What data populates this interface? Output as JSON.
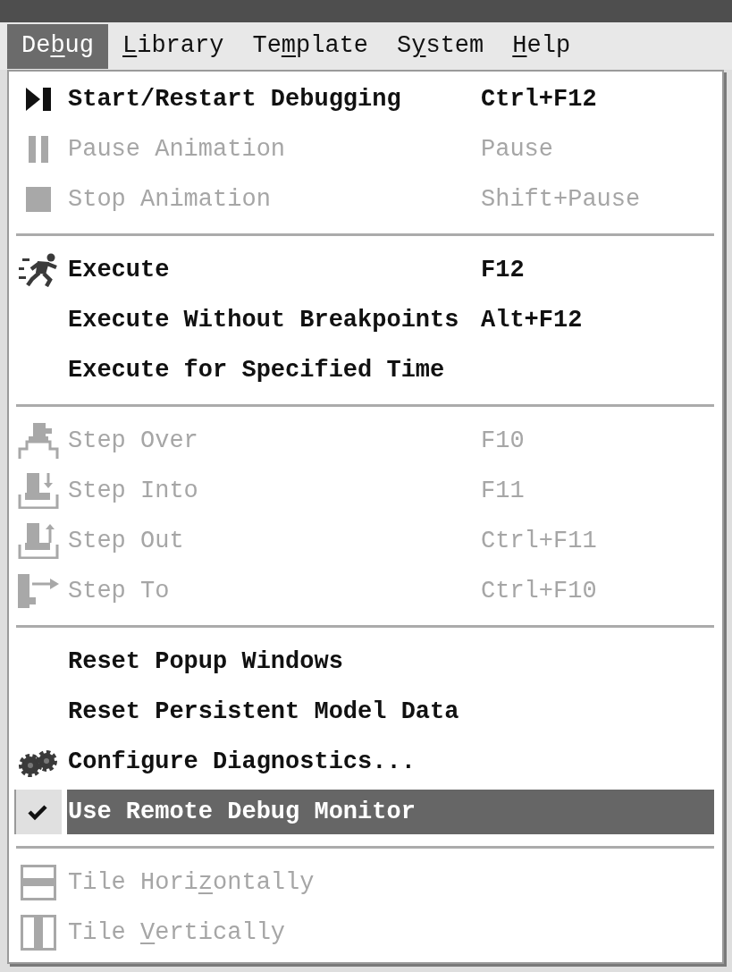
{
  "menu_bar": [
    {
      "label_parts": {
        "before": "De",
        "key": "b",
        "after": "ug"
      },
      "selected": true
    },
    {
      "label_parts": {
        "key": "L",
        "after": "ibrary"
      },
      "selected": false
    },
    {
      "label_parts": {
        "before": "Te",
        "key": "m",
        "after": "plate"
      },
      "selected": false
    },
    {
      "label_parts": {
        "before": "S",
        "key": "y",
        "after": "stem"
      },
      "selected": false
    },
    {
      "label_parts": {
        "key": "H",
        "after": "elp"
      },
      "selected": false
    }
  ],
  "menu": {
    "sections": [
      {
        "items": [
          {
            "kind": "command",
            "label": "Start/Restart Debugging",
            "shortcut": "Ctrl+F12",
            "disabled": false,
            "highlighted": false
          },
          {
            "kind": "command",
            "label": "Pause Animation",
            "shortcut": "Pause",
            "disabled": true,
            "highlighted": false
          },
          {
            "kind": "command",
            "label": "Stop Animation",
            "shortcut": "Shift+Pause",
            "disabled": true,
            "highlighted": false
          }
        ]
      },
      {
        "items": [
          {
            "kind": "command",
            "label": "Execute",
            "shortcut": "F12",
            "disabled": false,
            "highlighted": false
          },
          {
            "kind": "command",
            "label": "Execute Without Breakpoints",
            "shortcut": "Alt+F12",
            "disabled": false,
            "highlighted": false
          },
          {
            "kind": "command",
            "label": "Execute for Specified Time",
            "disabled": false,
            "highlighted": false
          }
        ]
      },
      {
        "items": [
          {
            "kind": "command",
            "label": "Step Over",
            "shortcut": "F10",
            "disabled": true,
            "highlighted": false
          },
          {
            "kind": "command",
            "label": "Step Into",
            "shortcut": "F11",
            "disabled": true,
            "highlighted": false
          },
          {
            "kind": "command",
            "label": "Step Out",
            "shortcut": "Ctrl+F11",
            "disabled": true,
            "highlighted": false
          },
          {
            "kind": "command",
            "label": "Step To",
            "shortcut": "Ctrl+F10",
            "disabled": true,
            "highlighted": false
          }
        ]
      },
      {
        "items": [
          {
            "kind": "command",
            "label": "Reset Popup Windows",
            "disabled": false,
            "highlighted": false
          },
          {
            "kind": "command",
            "label": "Reset Persistent Model Data",
            "disabled": false,
            "highlighted": false
          },
          {
            "kind": "command",
            "label": "Configure Diagnostics...",
            "disabled": false,
            "highlighted": false
          },
          {
            "kind": "toggle",
            "label": "Use Remote Debug Monitor",
            "checked": true,
            "disabled": false,
            "highlighted": true
          }
        ]
      },
      {
        "items": [
          {
            "kind": "command",
            "label_parts": {
              "before": "Tile Hori",
              "key": "z",
              "after": "ontally"
            },
            "disabled": true,
            "highlighted": false
          },
          {
            "kind": "command",
            "label_parts": {
              "before": "Tile ",
              "key": "V",
              "after": "ertically"
            },
            "disabled": true,
            "highlighted": false
          }
        ]
      }
    ]
  }
}
